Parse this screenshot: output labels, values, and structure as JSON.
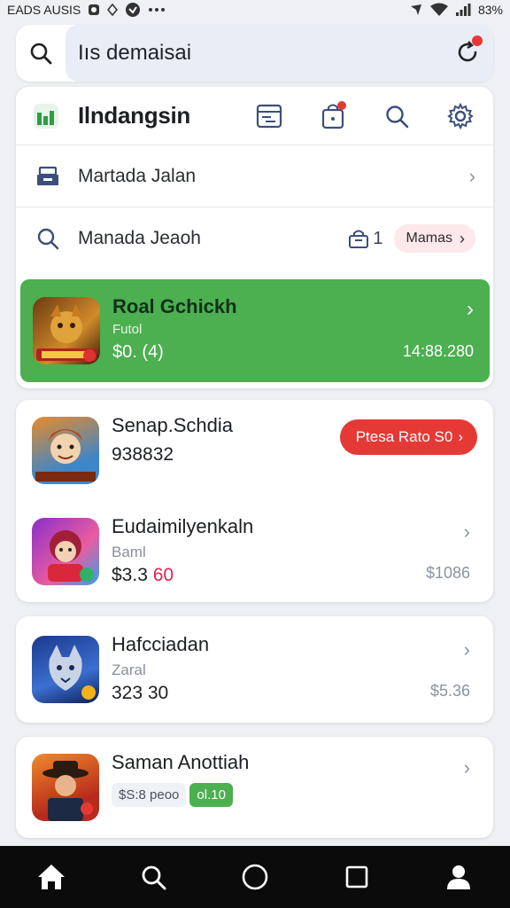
{
  "status_bar": {
    "left_text": "EADS AUSIS",
    "battery": "83%",
    "icons": [
      "app-icon",
      "diamond-icon",
      "shield-icon",
      "more-icon",
      "location-icon",
      "wifi-icon",
      "signal-icon"
    ]
  },
  "search": {
    "query": "Iıs demaisai",
    "icons": [
      "search-icon",
      "refresh-icon"
    ]
  },
  "header": {
    "title": "Ilndangsin",
    "icons": [
      "logo-icon",
      "filter-icon",
      "bag-icon",
      "search-icon",
      "gear-icon"
    ]
  },
  "menu": [
    {
      "label": "Martada Jalan",
      "icon": "store-icon"
    },
    {
      "label": "Manada Jeaoh",
      "icon": "search-icon",
      "count": "1",
      "pill": "Mamas"
    }
  ],
  "featured": {
    "name": "Roal Gchickh",
    "sub": "Futol",
    "price": "$0. (4)",
    "meta": "14:88.280"
  },
  "games": [
    {
      "name": "Senap.Schdia",
      "price": "938832",
      "button": "Ptesa Rato S0"
    },
    {
      "name": "Eudaimilyenkaln",
      "sub": "Baml",
      "price_main": "$3.3 ",
      "price_accent": "60",
      "meta": "$1086"
    },
    {
      "name": "Hafcciadan",
      "sub": "Zaral",
      "price": "323 30",
      "meta": "$5.36"
    },
    {
      "name": "Saman Anottiah",
      "tag_a": "$S:8 peoo",
      "tag_b": "ol.10"
    }
  ],
  "bottom_nav": [
    "home-icon",
    "search-icon",
    "circle-icon",
    "square-icon",
    "profile-icon"
  ],
  "colors": {
    "accent_green": "#4caf50",
    "accent_red": "#e53935",
    "search_field": "#e9edf6",
    "nav_bg": "#0b0b0c"
  }
}
